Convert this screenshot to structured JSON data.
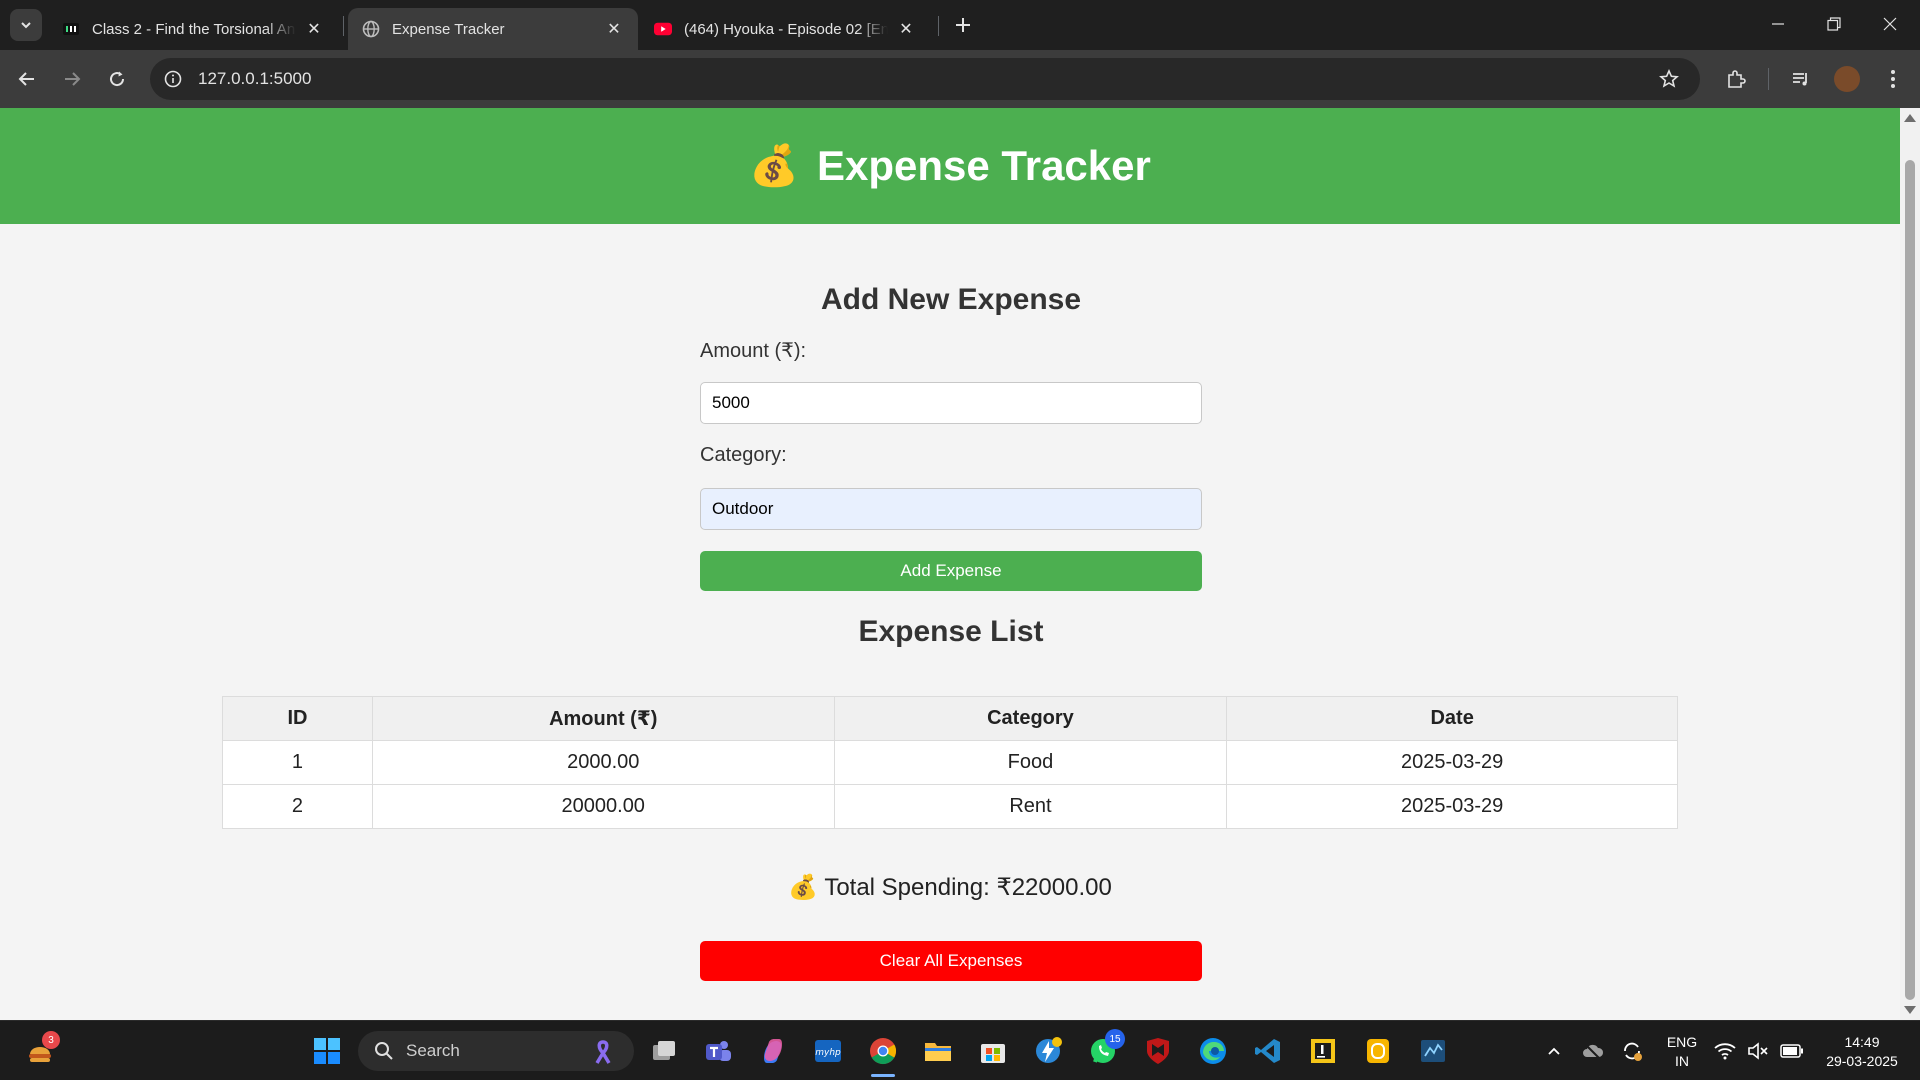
{
  "browser": {
    "tabs": [
      {
        "title": "Class 2 - Find the Torsional Ang"
      },
      {
        "title": "Expense Tracker"
      },
      {
        "title": "(464) Hyouka - Episode 02 [Eng"
      }
    ],
    "url": "127.0.0.1:5000"
  },
  "app": {
    "header_emoji": "💰",
    "title": "Expense Tracker"
  },
  "form": {
    "heading": "Add New Expense",
    "amount_label": "Amount (₹):",
    "amount_value": "5000",
    "category_label": "Category:",
    "category_value": "Outdoor",
    "submit_label": "Add Expense"
  },
  "list": {
    "heading": "Expense List",
    "columns": [
      "ID",
      "Amount (₹)",
      "Category",
      "Date"
    ],
    "rows": [
      {
        "id": "1",
        "amount": "2000.00",
        "category": "Food",
        "date": "2025-03-29"
      },
      {
        "id": "2",
        "amount": "20000.00",
        "category": "Rent",
        "date": "2025-03-29"
      }
    ]
  },
  "total": {
    "emoji": "💰",
    "text": "Total Spending: ₹22000.00"
  },
  "clear_label": "Clear All Expenses",
  "taskbar": {
    "search_placeholder": "Search",
    "widgets_badge": "3",
    "whatsapp_badge": "15",
    "language_line1": "ENG",
    "language_line2": "IN",
    "time": "14:49",
    "date": "29-03-2025"
  },
  "colors": {
    "accent_green": "#4caf50",
    "danger_red": "#ff0000",
    "page_bg": "#f4f4f4"
  }
}
